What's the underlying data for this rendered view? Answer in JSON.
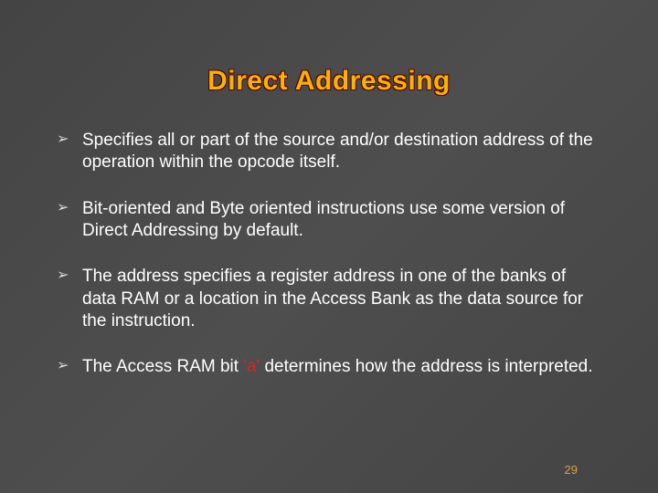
{
  "title": "Direct Addressing",
  "bullets": [
    {
      "text": "Specifies all or part of the source and/or destination address of the operation within the opcode itself."
    },
    {
      "text": "Bit-oriented and Byte oriented instructions use some version of Direct Addressing by default."
    },
    {
      "text": "The address specifies a register address in one of the banks of data RAM or a location in the Access Bank as the data source for the instruction."
    },
    {
      "prefix": "The Access RAM bit ",
      "accent": "'a'",
      "suffix": " determines how the address is interpreted."
    }
  ],
  "page_number": "29"
}
